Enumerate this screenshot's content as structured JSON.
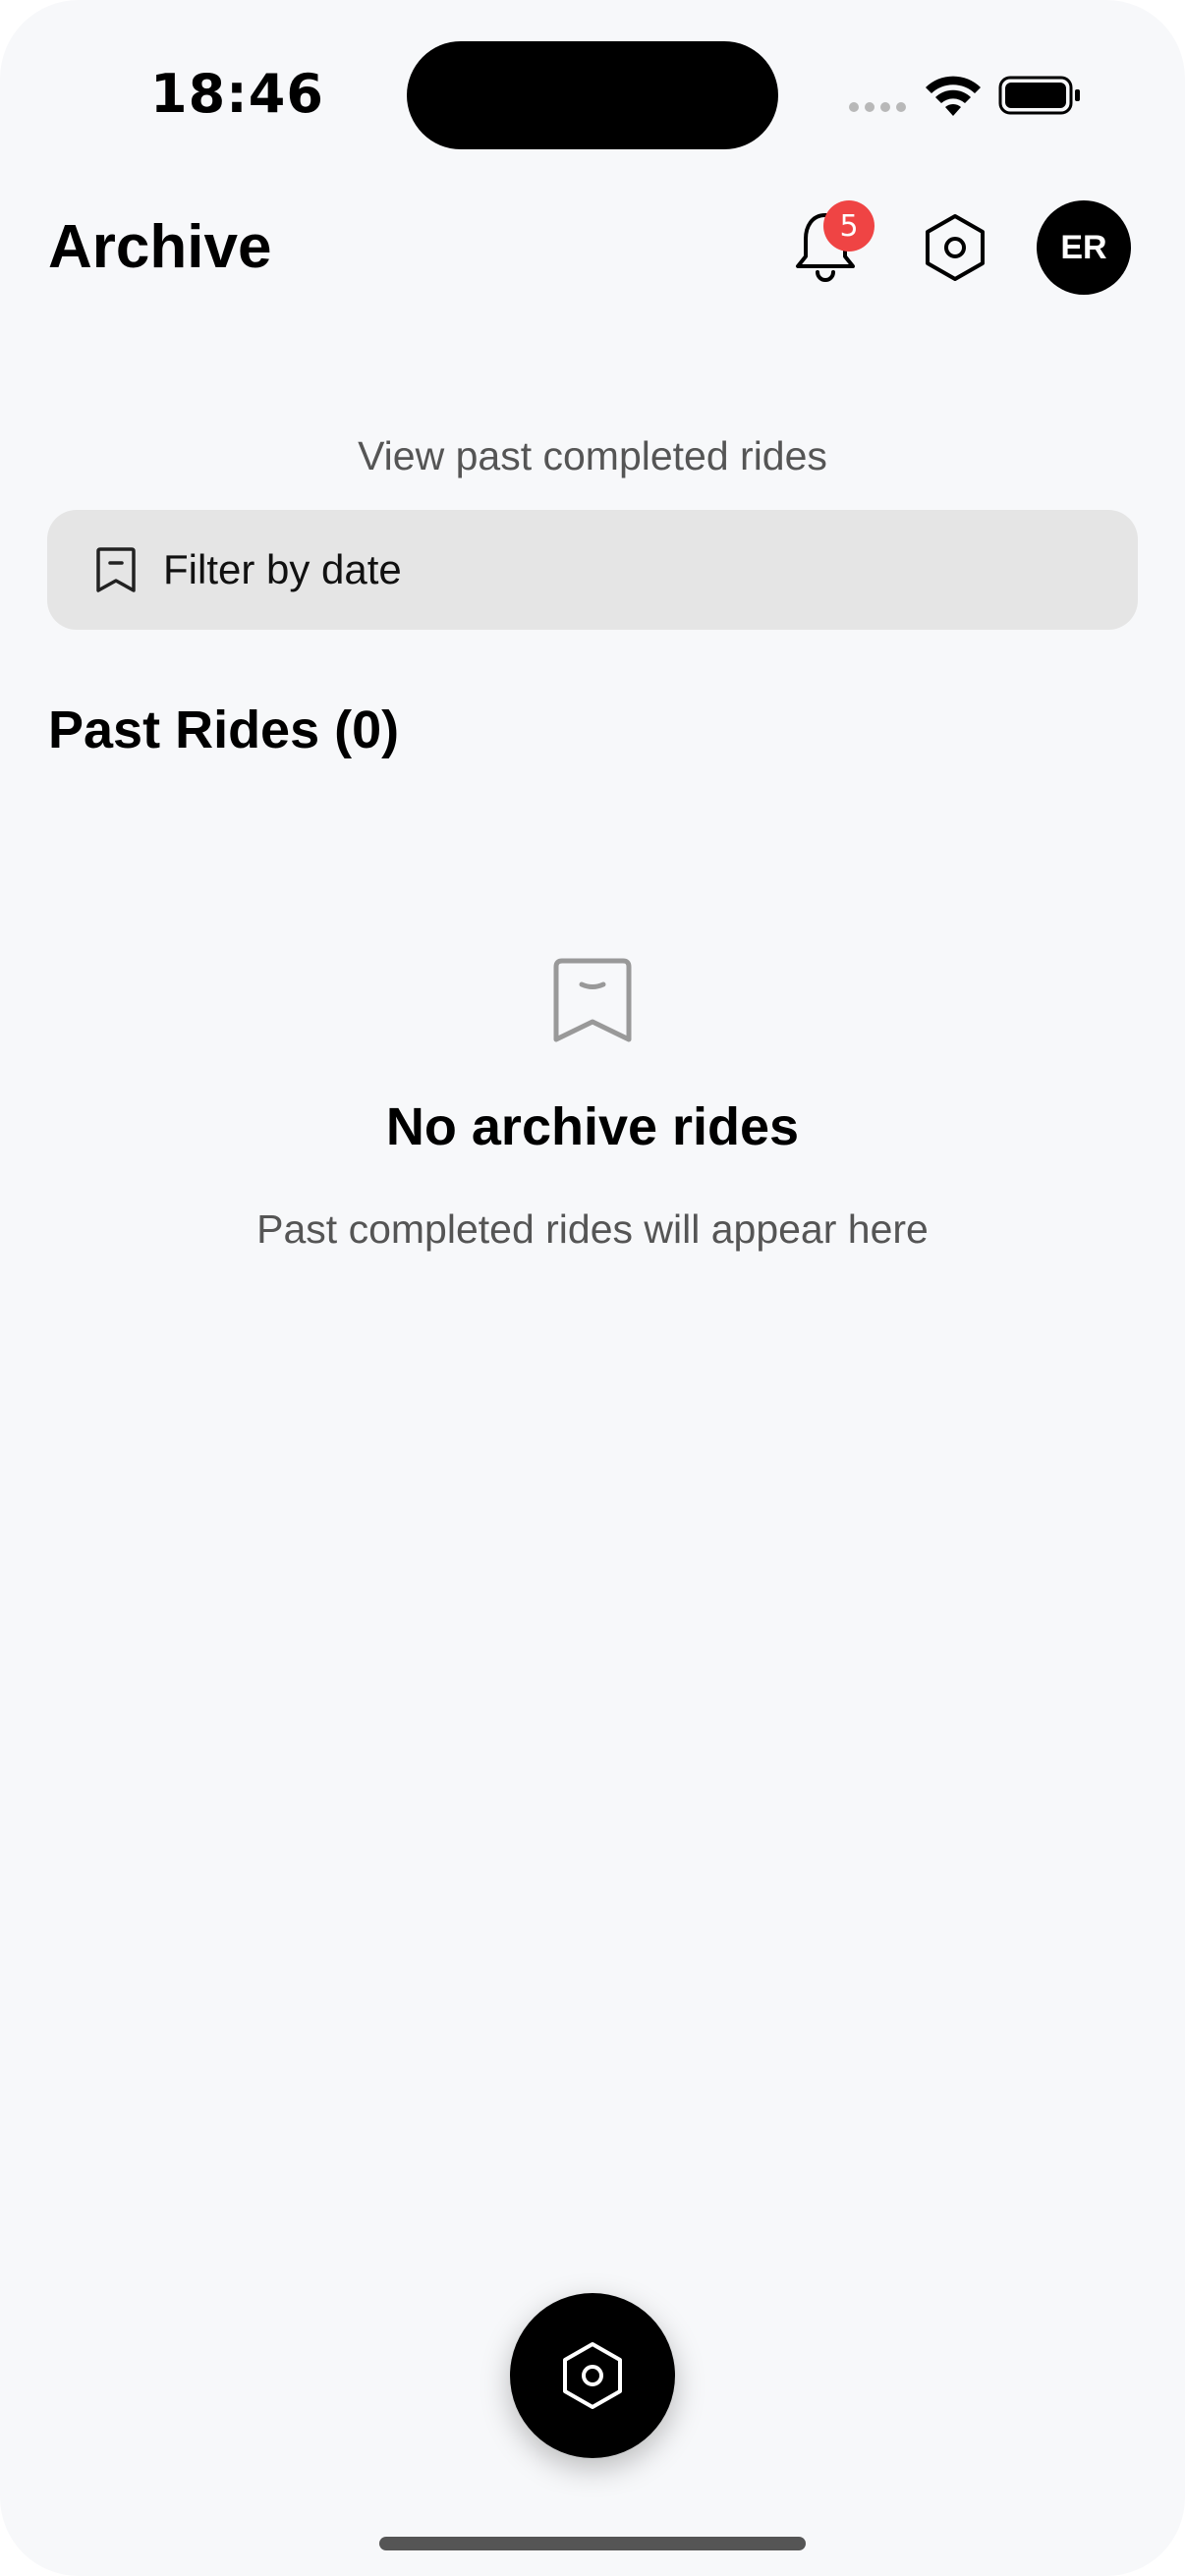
{
  "status_bar": {
    "time": "18:46"
  },
  "header": {
    "title": "Archive",
    "notification_count": "5",
    "avatar_initials": "ER"
  },
  "subtitle": "View past completed rides",
  "filter": {
    "label": "Filter by date"
  },
  "section": {
    "title": "Past Rides (0)"
  },
  "empty_state": {
    "title": "No archive rides",
    "subtitle": "Past completed rides will appear here"
  },
  "icons": {
    "bell": "bell-icon",
    "settings": "hexagon-settings-icon",
    "filter": "bookmark-icon",
    "empty": "bookmark-icon"
  },
  "colors": {
    "badge": "#ef4444",
    "background": "#f7f8fa",
    "filter_bg": "#e5e5e5"
  }
}
